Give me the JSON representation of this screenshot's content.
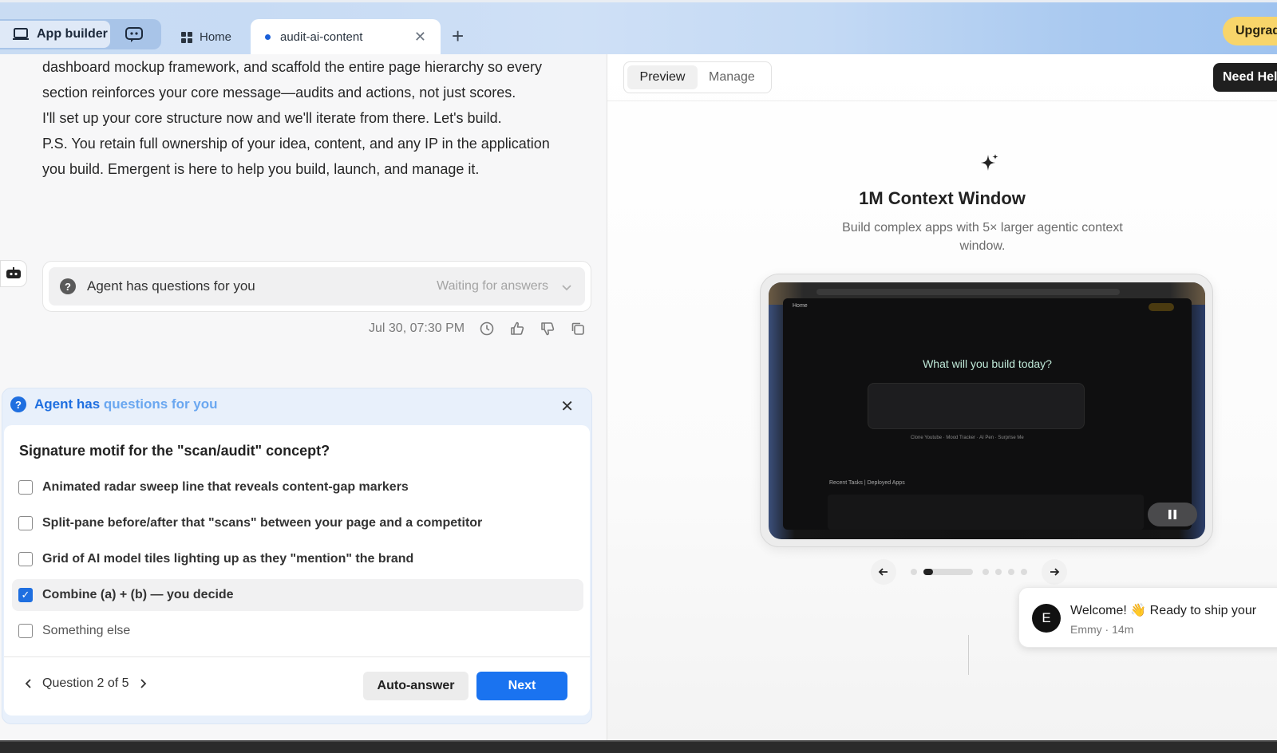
{
  "tabs": {
    "app_builder": "App builder",
    "home": "Home",
    "active": "audit-ai-content",
    "upgrade": "Upgrad"
  },
  "chat": {
    "message_lines": [
      "dashboard mockup framework, and scaffold the entire page hierarchy so every",
      "section reinforces your core message—audits and actions, not just scores.",
      "I'll set up your core structure now and we'll iterate from there. Let's build.",
      "P.S. You retain full ownership of your idea, content, and any IP in the application",
      "you build. Emergent is here to help you build, launch, and manage it."
    ],
    "question_card": {
      "label": "Agent has questions for you",
      "status": "Waiting for answers"
    },
    "timestamp": "Jul 30, 07:30 PM"
  },
  "question_panel": {
    "header_prefix": "Agent has ",
    "header_suffix": "questions for you",
    "question": "Signature motif for the \"scan/audit\" concept?",
    "options": [
      {
        "label": "Animated radar sweep line that reveals content-gap markers",
        "checked": false
      },
      {
        "label": "Split-pane before/after that \"scans\" between your page and a competitor",
        "checked": false
      },
      {
        "label": "Grid of AI model tiles lighting up as they \"mention\" the brand",
        "checked": false
      },
      {
        "label": "Combine (a) + (b) — you decide",
        "checked": true
      },
      {
        "label": "Something else",
        "checked": false
      }
    ],
    "progress": "Question 2 of 5",
    "auto_answer": "Auto-answer",
    "next": "Next"
  },
  "preview": {
    "tab_preview": "Preview",
    "tab_manage": "Manage",
    "need_help": "Need Hel",
    "feature_title": "1M Context Window",
    "feature_desc": "Build complex apps with 5× larger agentic context window.",
    "screen": {
      "home": "Home",
      "question": "What will you build today?",
      "chips": "Clone Youtube  ·  Mood Tracker  ·  AI Pen  ·  Surprise Me",
      "tasks": "Recent Tasks  |  Deployed Apps"
    },
    "carousel": {
      "current": 2,
      "total": 7
    },
    "welcome": {
      "avatar": "E",
      "text": "Welcome! 👋 Ready to ship your",
      "sender": "Emmy",
      "time": "14m"
    }
  },
  "colors": {
    "accent": "#1a73f0",
    "upgrade": "#f8d56a",
    "question_header": "#3a86e8"
  }
}
